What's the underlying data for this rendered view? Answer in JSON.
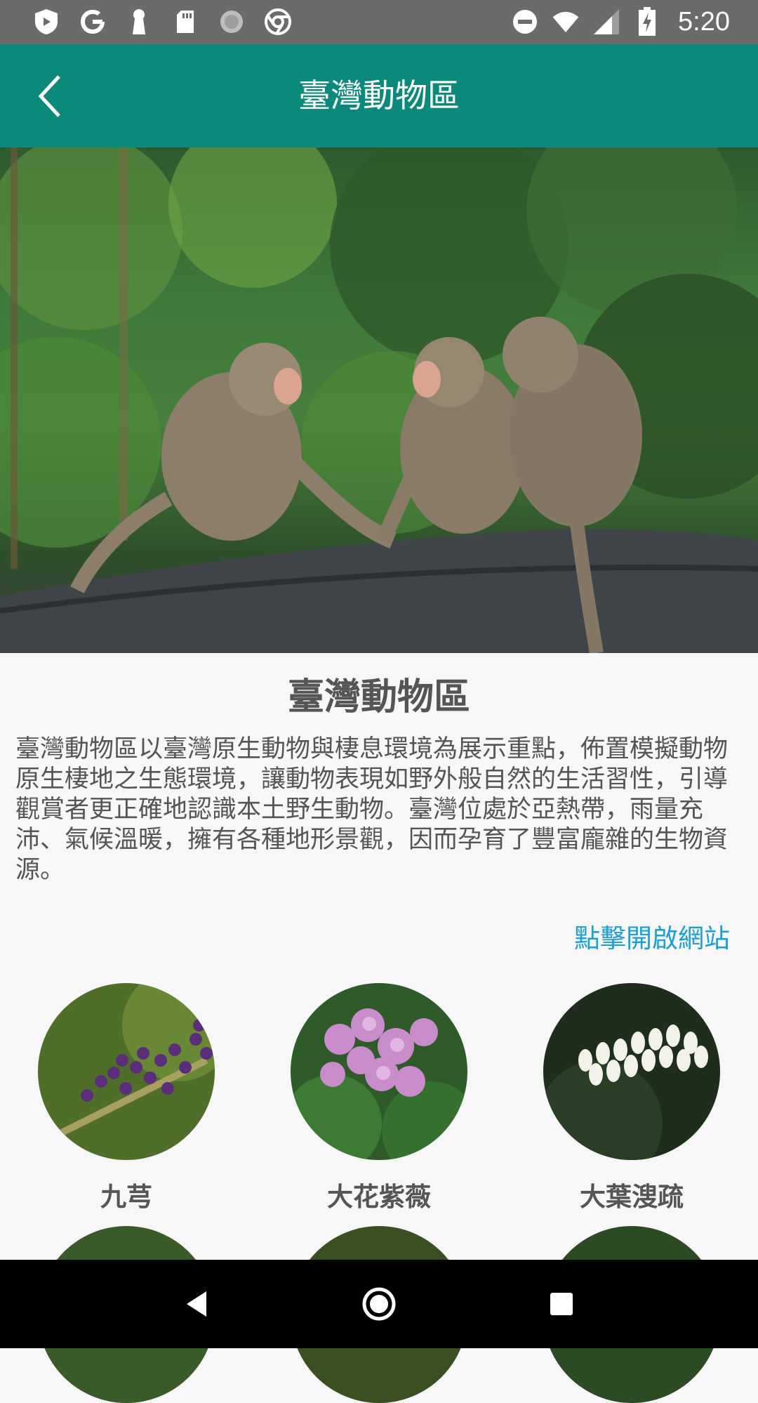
{
  "status_bar": {
    "time": "5:20",
    "icons_left": [
      "shield-icon",
      "google-icon",
      "keyhole-icon",
      "sd-card-icon",
      "loading-icon",
      "chrome-icon"
    ],
    "icons_right": [
      "do-not-disturb-icon",
      "wifi-icon",
      "signal-icon",
      "battery-charging-icon"
    ]
  },
  "app_bar": {
    "title": "臺灣動物區",
    "back_icon": "chevron-left-icon",
    "color": "#0b8a7c"
  },
  "hero": {
    "subject": "two-macaques-on-log"
  },
  "section": {
    "title": "臺灣動物區",
    "description": "臺灣動物區以臺灣原生動物與棲息環境為展示重點，佈置模擬動物原生棲地之生態環境，讓動物表現如野外般自然的生活習性，引導觀賞者更正確地認識本土野生動物。臺灣位處於亞熱帶，雨量充沛、氣候溫暖，擁有各種地形景觀，因而孕育了豐富龐雜的生物資源。",
    "link_label": "點擊開啟網站",
    "link_color": "#1a9fd6"
  },
  "plants": [
    {
      "name": "九芎",
      "icon": "purple-berries-photo"
    },
    {
      "name": "大花紫薇",
      "icon": "pink-flowers-photo"
    },
    {
      "name": "大葉溲疏",
      "icon": "white-flowers-photo"
    }
  ],
  "nav_bar": {
    "back": "back-triangle-icon",
    "home": "home-circle-icon",
    "recents": "recents-square-icon"
  }
}
